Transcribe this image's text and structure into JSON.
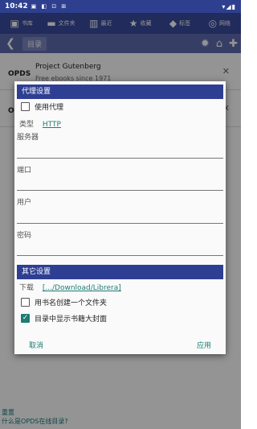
{
  "statusbar": {
    "time": "10:42",
    "icons": "▣ ◧ ⊡ ⊞",
    "right": "▾◢▮"
  },
  "topnav": [
    {
      "name": "library",
      "icon": "▣",
      "label": "书库"
    },
    {
      "name": "folder",
      "icon": "▬",
      "label": "文件夹"
    },
    {
      "name": "recent",
      "icon": "▥",
      "label": "最近"
    },
    {
      "name": "favorite",
      "icon": "★",
      "label": "收藏"
    },
    {
      "name": "tags",
      "icon": "◆",
      "label": "标签"
    },
    {
      "name": "network",
      "icon": "◎",
      "label": "网络"
    }
  ],
  "header": {
    "title": "目录"
  },
  "list": [
    {
      "badge": "OPDS",
      "title": "Project Gutenberg",
      "subtitle": "Free ebooks since 1971"
    },
    {
      "badge": "OPDS",
      "title": "",
      "subtitle": ""
    }
  ],
  "dialog": {
    "proxy_header": "代理设置",
    "use_proxy": "使用代理",
    "type_label": "类型",
    "type_value": "HTTP",
    "server_label": "服务器",
    "port_label": "端口",
    "user_label": "用户",
    "password_label": "密码",
    "other_header": "其它设置",
    "download_label": "下载",
    "download_path": "[.../Download/Librera]",
    "create_folder": "用书名创建一个文件夹",
    "show_cover": "目录中显示书籍大封面",
    "cancel": "取消",
    "apply": "应用"
  },
  "footer": {
    "reset": "重置",
    "help": "什么是OPDS在线目录?"
  }
}
